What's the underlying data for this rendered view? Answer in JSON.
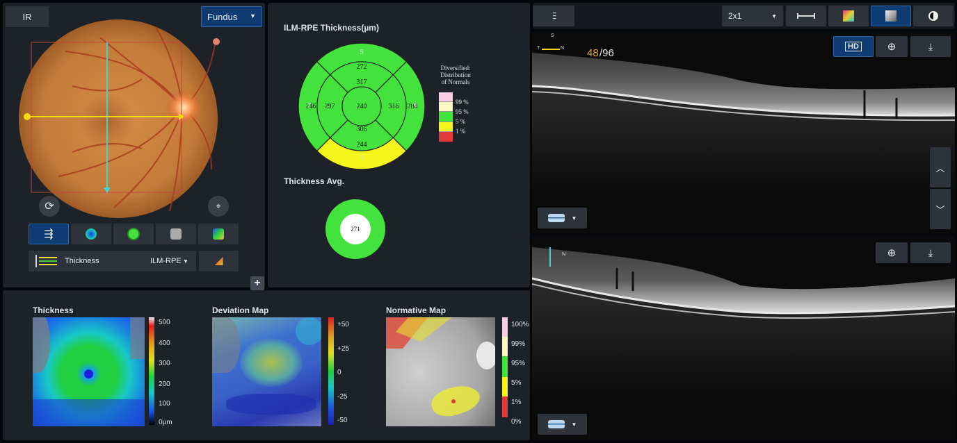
{
  "fundus_panel": {
    "mode_label": "IR",
    "view_select": "Fundus",
    "layer_thickness_label": "Thickness",
    "layer_select": "ILM-RPE"
  },
  "chart_panel": {
    "title": "ILM-RPE Thickness(µm)",
    "directions": {
      "s": "S",
      "i": "I",
      "t": "T",
      "n": "N"
    },
    "sectors": {
      "outer_top": "272",
      "inner_top": "317",
      "center": "240",
      "inner_temporal": "297",
      "outer_temporal": "246",
      "inner_nasal": "316",
      "outer_nasal": "284",
      "inner_bottom": "306",
      "outer_bottom": "244"
    },
    "legend_title_1": "Diversified:",
    "legend_title_2": "Distribution",
    "legend_title_3": "of Normals",
    "legend": [
      "99 %",
      "95 %",
      "5 %",
      "1 %"
    ],
    "avg_title": "Thickness Avg.",
    "avg_value": "271"
  },
  "maps": {
    "thickness": {
      "title": "Thickness",
      "scale": [
        "500",
        "400",
        "300",
        "200",
        "100",
        "0µm"
      ]
    },
    "deviation": {
      "title": "Deviation Map",
      "scale": [
        "+50",
        "+25",
        "0",
        "-25",
        "-50"
      ]
    },
    "normative": {
      "title": "Normative Map",
      "scale": [
        "100%",
        "99%",
        "95%",
        "5%",
        "1%",
        "0%"
      ]
    }
  },
  "oct": {
    "layout_select": "2x1",
    "hd_label": "HD",
    "slice_current": "48",
    "slice_total": "/96",
    "dir_s": "S",
    "dir_t": "T",
    "dir_n": "N"
  },
  "colors": {
    "normal_green": "#44e23c",
    "borderline_yellow": "#f5f51c",
    "abnormal_red": "#e03a3a",
    "high_pink": "#f8cfe0",
    "high_cream": "#fbf8c4",
    "accent_blue": "#0f3d73",
    "fundus_orange": "#c9803f"
  },
  "icons": [
    "adjust-sliders-icon",
    "caliper-icon",
    "color-palette-icon",
    "grayscale-icon",
    "contrast-icon",
    "zoom-in-icon",
    "download-icon",
    "refresh-icon",
    "target-icon",
    "plus-icon",
    "chevron-up-icon",
    "chevron-down-icon"
  ]
}
